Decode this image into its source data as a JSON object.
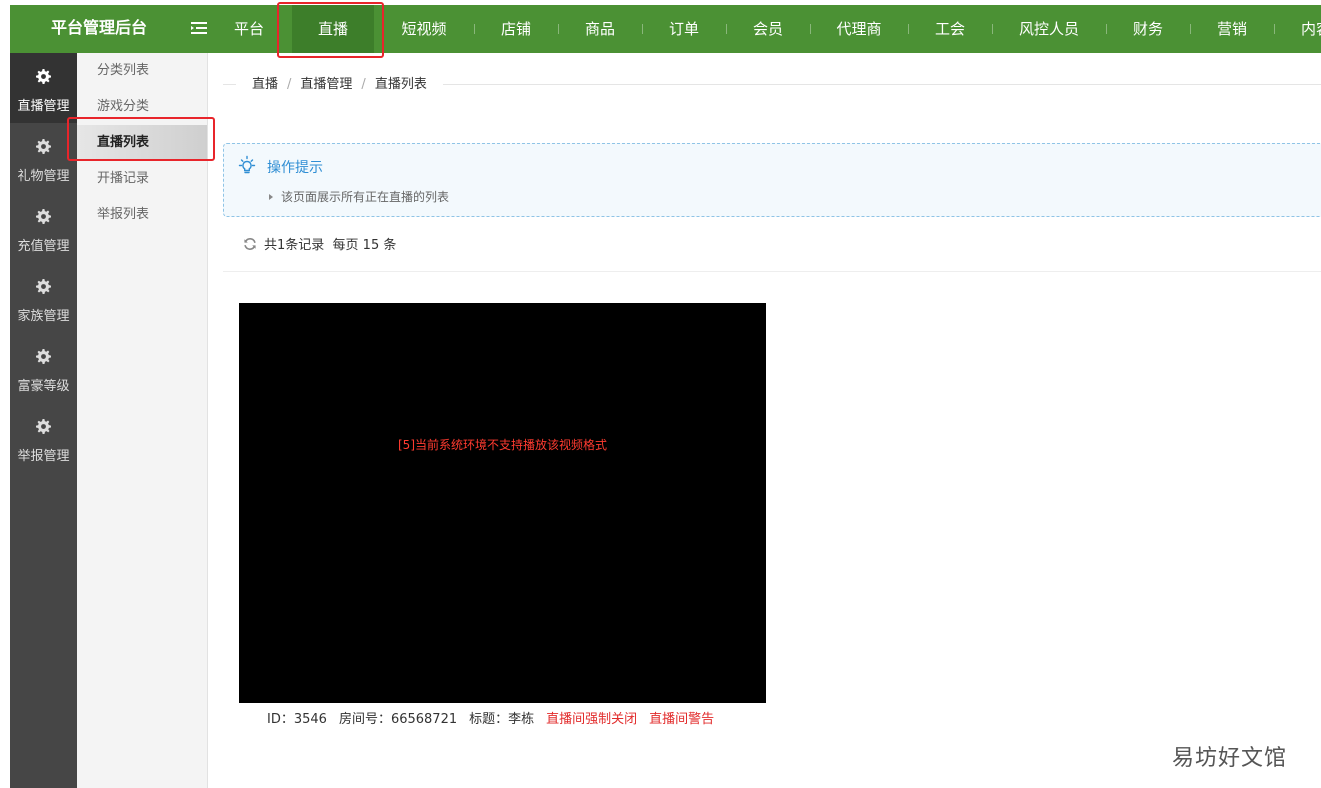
{
  "header": {
    "brand": "平台管理后台",
    "nav": [
      "平台",
      "直播",
      "短视频",
      "店铺",
      "商品",
      "订单",
      "会员",
      "代理商",
      "工会",
      "风控人员",
      "财务",
      "营销",
      "内容"
    ],
    "active_nav": "直播"
  },
  "sidebar": {
    "items": [
      "直播管理",
      "礼物管理",
      "充值管理",
      "家族管理",
      "富豪等级",
      "举报管理"
    ],
    "active": "直播管理"
  },
  "submenu": {
    "items": [
      "分类列表",
      "游戏分类",
      "直播列表",
      "开播记录",
      "举报列表"
    ],
    "active": "直播列表"
  },
  "breadcrumb": {
    "items": [
      "直播",
      "直播管理",
      "直播列表"
    ],
    "separator": "/"
  },
  "tips": {
    "title": "操作提示",
    "lines": [
      "该页面展示所有正在直播的列表"
    ]
  },
  "records": {
    "summary": "共1条记录",
    "per_page": "每页 15 条"
  },
  "live": {
    "player_message": "[5]当前系统环境不支持播放该视频格式",
    "id": "ID：3546",
    "room": "房间号：66568721",
    "title": "标题：李栋",
    "action_close": "直播间强制关闭",
    "action_warn": "直播间警告"
  },
  "watermark": "易坊好文馆",
  "colors": {
    "topbar": "#4b9134",
    "topbar_active": "#3d7e2a",
    "sidebar": "#464646",
    "highlight": "#e8252b",
    "danger": "#e22b2b",
    "tip_title": "#2f8ed4"
  }
}
